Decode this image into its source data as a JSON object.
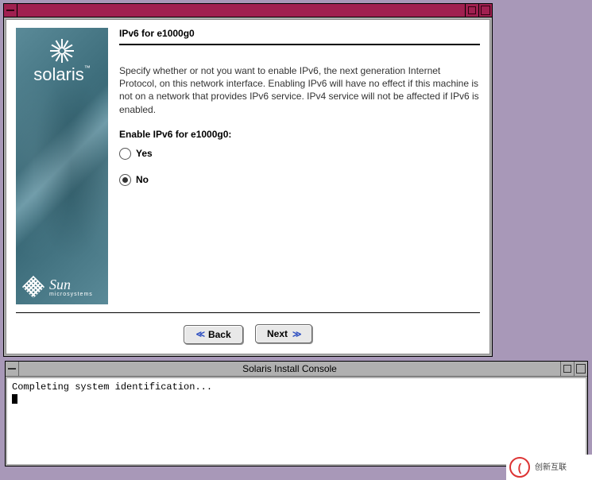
{
  "installer": {
    "brand": {
      "product": "solaris",
      "vendor_top": "Sun",
      "vendor_bottom": "microsystems"
    },
    "page_title": "IPv6 for e1000g0",
    "description": "Specify whether or not you want to enable IPv6, the next generation Internet Protocol, on this network interface.  Enabling IPv6 will have no effect if this machine is not on a network that provides IPv6 service.  IPv4 service will not be affected if IPv6 is enabled.",
    "field_label": "Enable IPv6 for e1000g0:",
    "options": {
      "yes": "Yes",
      "no": "No",
      "selected": "no"
    },
    "buttons": {
      "back": "Back",
      "next": "Next"
    }
  },
  "console": {
    "title": "Solaris Install Console",
    "line1": "Completing system identification..."
  },
  "watermark": {
    "text": "创新互联"
  }
}
